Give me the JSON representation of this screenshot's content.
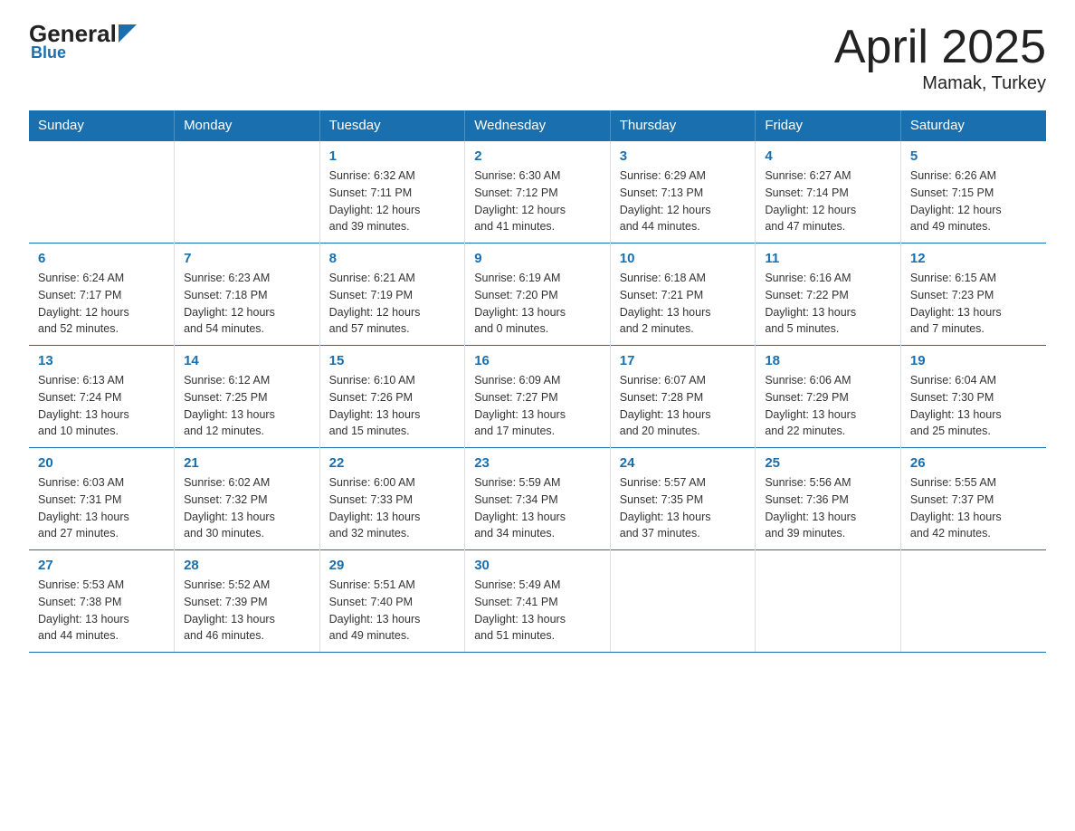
{
  "header": {
    "logo_general": "General",
    "logo_blue": "Blue",
    "month_year": "April 2025",
    "location": "Mamak, Turkey"
  },
  "weekdays": [
    "Sunday",
    "Monday",
    "Tuesday",
    "Wednesday",
    "Thursday",
    "Friday",
    "Saturday"
  ],
  "weeks": [
    [
      {
        "day": "",
        "info": ""
      },
      {
        "day": "",
        "info": ""
      },
      {
        "day": "1",
        "info": "Sunrise: 6:32 AM\nSunset: 7:11 PM\nDaylight: 12 hours\nand 39 minutes."
      },
      {
        "day": "2",
        "info": "Sunrise: 6:30 AM\nSunset: 7:12 PM\nDaylight: 12 hours\nand 41 minutes."
      },
      {
        "day": "3",
        "info": "Sunrise: 6:29 AM\nSunset: 7:13 PM\nDaylight: 12 hours\nand 44 minutes."
      },
      {
        "day": "4",
        "info": "Sunrise: 6:27 AM\nSunset: 7:14 PM\nDaylight: 12 hours\nand 47 minutes."
      },
      {
        "day": "5",
        "info": "Sunrise: 6:26 AM\nSunset: 7:15 PM\nDaylight: 12 hours\nand 49 minutes."
      }
    ],
    [
      {
        "day": "6",
        "info": "Sunrise: 6:24 AM\nSunset: 7:17 PM\nDaylight: 12 hours\nand 52 minutes."
      },
      {
        "day": "7",
        "info": "Sunrise: 6:23 AM\nSunset: 7:18 PM\nDaylight: 12 hours\nand 54 minutes."
      },
      {
        "day": "8",
        "info": "Sunrise: 6:21 AM\nSunset: 7:19 PM\nDaylight: 12 hours\nand 57 minutes."
      },
      {
        "day": "9",
        "info": "Sunrise: 6:19 AM\nSunset: 7:20 PM\nDaylight: 13 hours\nand 0 minutes."
      },
      {
        "day": "10",
        "info": "Sunrise: 6:18 AM\nSunset: 7:21 PM\nDaylight: 13 hours\nand 2 minutes."
      },
      {
        "day": "11",
        "info": "Sunrise: 6:16 AM\nSunset: 7:22 PM\nDaylight: 13 hours\nand 5 minutes."
      },
      {
        "day": "12",
        "info": "Sunrise: 6:15 AM\nSunset: 7:23 PM\nDaylight: 13 hours\nand 7 minutes."
      }
    ],
    [
      {
        "day": "13",
        "info": "Sunrise: 6:13 AM\nSunset: 7:24 PM\nDaylight: 13 hours\nand 10 minutes."
      },
      {
        "day": "14",
        "info": "Sunrise: 6:12 AM\nSunset: 7:25 PM\nDaylight: 13 hours\nand 12 minutes."
      },
      {
        "day": "15",
        "info": "Sunrise: 6:10 AM\nSunset: 7:26 PM\nDaylight: 13 hours\nand 15 minutes."
      },
      {
        "day": "16",
        "info": "Sunrise: 6:09 AM\nSunset: 7:27 PM\nDaylight: 13 hours\nand 17 minutes."
      },
      {
        "day": "17",
        "info": "Sunrise: 6:07 AM\nSunset: 7:28 PM\nDaylight: 13 hours\nand 20 minutes."
      },
      {
        "day": "18",
        "info": "Sunrise: 6:06 AM\nSunset: 7:29 PM\nDaylight: 13 hours\nand 22 minutes."
      },
      {
        "day": "19",
        "info": "Sunrise: 6:04 AM\nSunset: 7:30 PM\nDaylight: 13 hours\nand 25 minutes."
      }
    ],
    [
      {
        "day": "20",
        "info": "Sunrise: 6:03 AM\nSunset: 7:31 PM\nDaylight: 13 hours\nand 27 minutes."
      },
      {
        "day": "21",
        "info": "Sunrise: 6:02 AM\nSunset: 7:32 PM\nDaylight: 13 hours\nand 30 minutes."
      },
      {
        "day": "22",
        "info": "Sunrise: 6:00 AM\nSunset: 7:33 PM\nDaylight: 13 hours\nand 32 minutes."
      },
      {
        "day": "23",
        "info": "Sunrise: 5:59 AM\nSunset: 7:34 PM\nDaylight: 13 hours\nand 34 minutes."
      },
      {
        "day": "24",
        "info": "Sunrise: 5:57 AM\nSunset: 7:35 PM\nDaylight: 13 hours\nand 37 minutes."
      },
      {
        "day": "25",
        "info": "Sunrise: 5:56 AM\nSunset: 7:36 PM\nDaylight: 13 hours\nand 39 minutes."
      },
      {
        "day": "26",
        "info": "Sunrise: 5:55 AM\nSunset: 7:37 PM\nDaylight: 13 hours\nand 42 minutes."
      }
    ],
    [
      {
        "day": "27",
        "info": "Sunrise: 5:53 AM\nSunset: 7:38 PM\nDaylight: 13 hours\nand 44 minutes."
      },
      {
        "day": "28",
        "info": "Sunrise: 5:52 AM\nSunset: 7:39 PM\nDaylight: 13 hours\nand 46 minutes."
      },
      {
        "day": "29",
        "info": "Sunrise: 5:51 AM\nSunset: 7:40 PM\nDaylight: 13 hours\nand 49 minutes."
      },
      {
        "day": "30",
        "info": "Sunrise: 5:49 AM\nSunset: 7:41 PM\nDaylight: 13 hours\nand 51 minutes."
      },
      {
        "day": "",
        "info": ""
      },
      {
        "day": "",
        "info": ""
      },
      {
        "day": "",
        "info": ""
      }
    ]
  ]
}
